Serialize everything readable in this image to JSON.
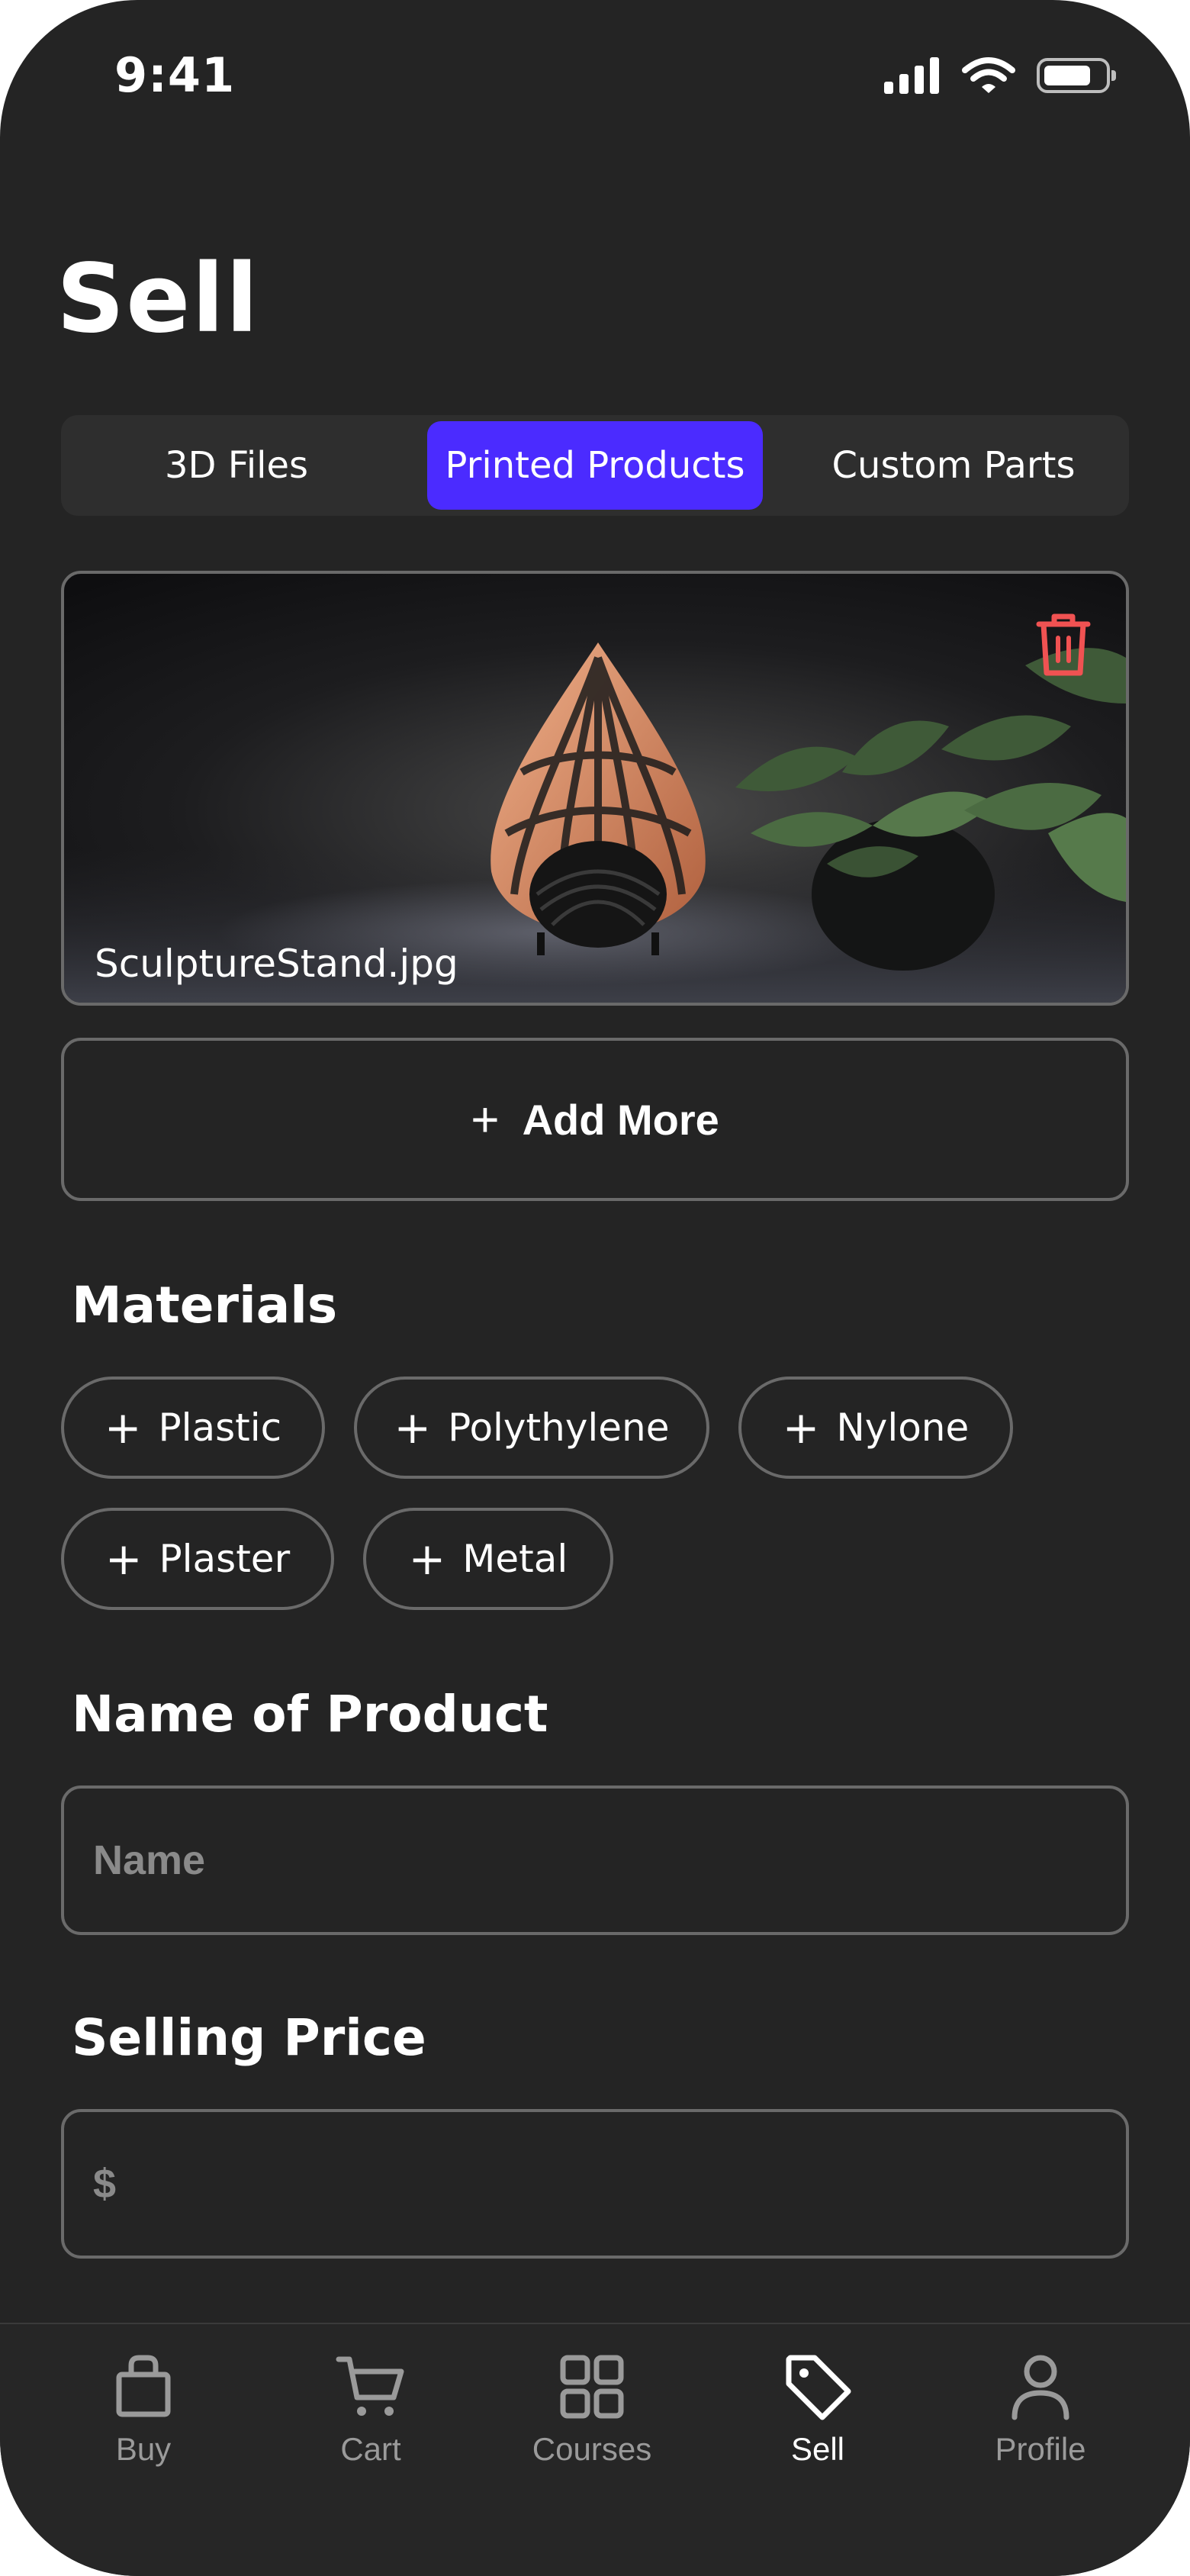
{
  "status_bar": {
    "time": "9:41"
  },
  "page": {
    "title": "Sell"
  },
  "segments": [
    {
      "label": "3D Files",
      "active": false
    },
    {
      "label": "Printed Products",
      "active": true
    },
    {
      "label": "Custom Parts",
      "active": false
    }
  ],
  "image_card": {
    "file_name": "SculptureStand.jpg"
  },
  "add_more": {
    "label": "Add More"
  },
  "materials": {
    "title": "Materials",
    "chips": [
      "Plastic",
      "Polythylene",
      "Nylone",
      "Plaster",
      "Metal"
    ]
  },
  "product_name": {
    "title": "Name of Product",
    "placeholder": "Name"
  },
  "selling_price": {
    "title": "Selling Price",
    "placeholder": "$"
  },
  "tabbar": {
    "items": [
      {
        "label": "Buy",
        "icon": "bag-icon"
      },
      {
        "label": "Cart",
        "icon": "cart-icon"
      },
      {
        "label": "Courses",
        "icon": "grid-icon"
      },
      {
        "label": "Sell",
        "icon": "tag-icon",
        "active": true
      },
      {
        "label": "Profile",
        "icon": "user-icon"
      }
    ]
  },
  "colors": {
    "accent": "#4b2bff",
    "background": "#242424",
    "danger": "#f05252"
  }
}
